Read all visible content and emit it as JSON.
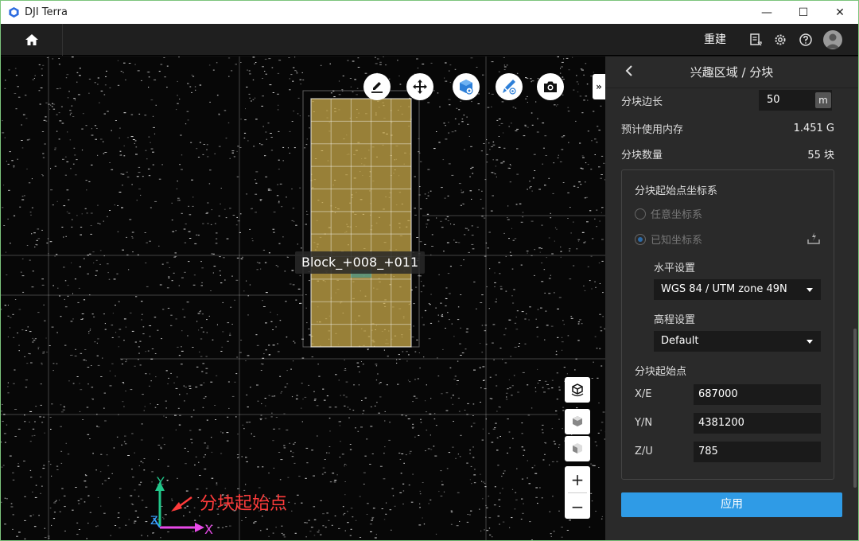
{
  "window": {
    "title": "DJI Terra",
    "minimize": "—",
    "maximize": "☐",
    "close": "✕"
  },
  "toolbar": {
    "rebuild_label": "重建",
    "icons": [
      "home-icon",
      "report-icon",
      "gear-icon",
      "help-icon",
      "avatar-icon"
    ]
  },
  "viewport": {
    "tools": [
      "edit-icon",
      "move-icon",
      "cube-view-icon",
      "brush-view-icon",
      "camera-icon"
    ],
    "collapse_label": "»",
    "block_label": "Block_+008_+011",
    "zoom_in": "+",
    "zoom_out": "−",
    "annotation": "分块起始点",
    "axes": {
      "x": "X",
      "y": "Y",
      "z": "Z"
    },
    "colors": {
      "block_fill": "#c9a94a",
      "axis_x": "#e84ae8",
      "axis_y": "#21c78a",
      "axis_z": "#3aa0ff"
    }
  },
  "panel": {
    "title": "兴趣区域 / 分块",
    "block_edge": {
      "label": "分块边长",
      "value": "50",
      "unit": "m"
    },
    "memory": {
      "label": "预计使用内存",
      "value": "1.451 G"
    },
    "count": {
      "label": "分块数量",
      "value": "55 块"
    },
    "coord_system": {
      "title": "分块起始点坐标系",
      "option_any": "任意坐标系",
      "option_known": "已知坐标系",
      "selected": "已知坐标系",
      "horizontal_label": "水平设置",
      "horizontal_value": "WGS 84 / UTM zone 49N",
      "elevation_label": "高程设置",
      "elevation_value": "Default"
    },
    "origin": {
      "title": "分块起始点",
      "x_label": "X/E",
      "x_value": "687000",
      "y_label": "Y/N",
      "y_value": "4381200",
      "z_label": "Z/U",
      "z_value": "785"
    },
    "apply_label": "应用",
    "accent": "#2f9be6"
  }
}
